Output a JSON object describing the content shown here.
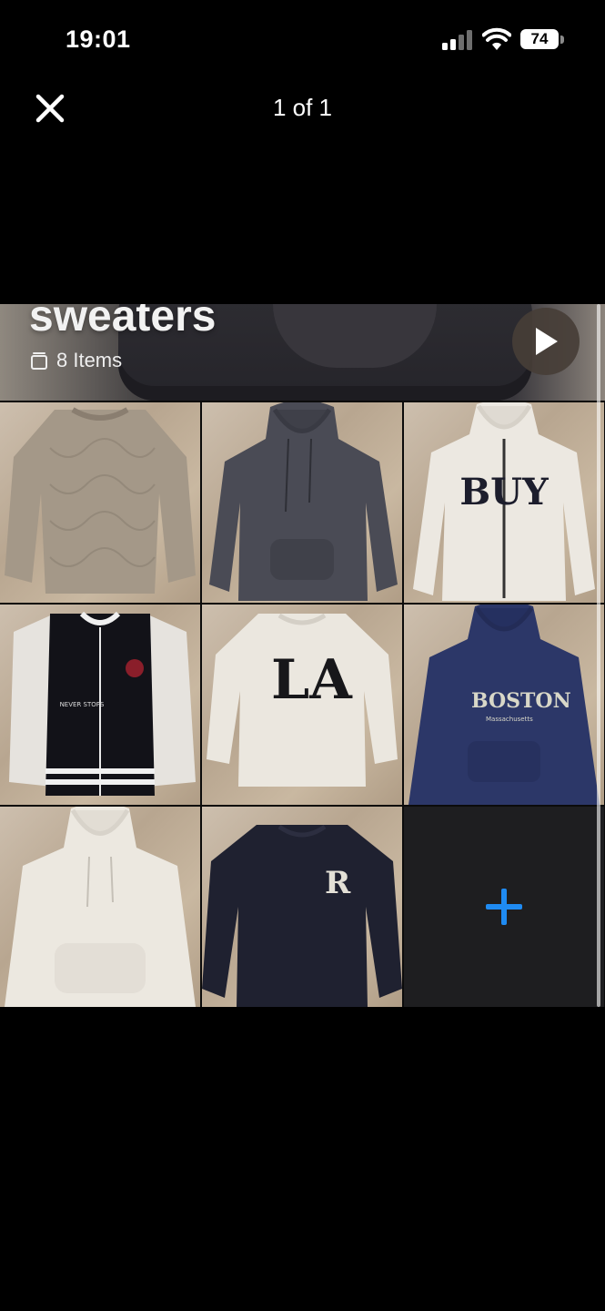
{
  "status_bar": {
    "time": "19:01",
    "battery": "74"
  },
  "viewer": {
    "counter": "1 of 1"
  },
  "collection": {
    "title": "sweaters",
    "count_label": "8 Items"
  },
  "items": [
    {
      "name": "beige-knit-sweater"
    },
    {
      "name": "charcoal-hoodie"
    },
    {
      "name": "cream-zip-hoodie"
    },
    {
      "name": "varsity-jacket",
      "print": "NEVER STOPS"
    },
    {
      "name": "la-sweatshirt",
      "print": "LA"
    },
    {
      "name": "boston-hoodie",
      "print": "BOSTON",
      "sub": "Massachusetts"
    },
    {
      "name": "cream-hoodie"
    },
    {
      "name": "navy-r-sweatshirt",
      "print": "R"
    }
  ],
  "colors": {
    "add_accent": "#1f8bf2",
    "background": "#000000"
  }
}
